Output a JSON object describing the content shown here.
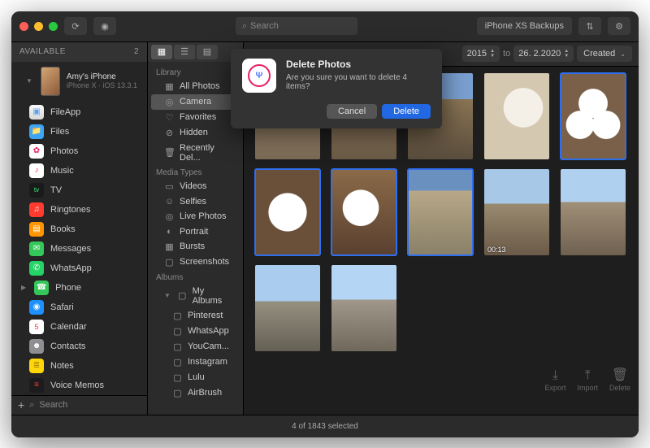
{
  "titlebar": {
    "search_placeholder": "Search",
    "backups_label": "iPhone XS  Backups"
  },
  "sidebar": {
    "header": "AVAILABLE",
    "count": "2",
    "device": {
      "name": "Amy's iPhone",
      "sub": "iPhone X · iOS 13.3.1"
    },
    "apps": [
      {
        "label": "FileApp",
        "bg": "linear-gradient(#f8f8f8,#d8d8d8)",
        "fg": "#5aa0f0",
        "glyph": "▣"
      },
      {
        "label": "Files",
        "bg": "#3ea5f5",
        "glyph": "📁"
      },
      {
        "label": "Photos",
        "bg": "#fff",
        "fg": "#e91e63",
        "glyph": "✿"
      },
      {
        "label": "Music",
        "bg": "#fff",
        "fg": "#fa2d48",
        "glyph": "♪"
      },
      {
        "label": "TV",
        "bg": "#1a1a1a",
        "glyph": "tv",
        "fg": "#3bf07a",
        "fs": "8px"
      },
      {
        "label": "Ringtones",
        "bg": "#ff3b30",
        "glyph": "♫"
      },
      {
        "label": "Books",
        "bg": "#ff9500",
        "glyph": "▤"
      },
      {
        "label": "Messages",
        "bg": "#34c759",
        "glyph": "✉"
      },
      {
        "label": "WhatsApp",
        "bg": "#25d366",
        "glyph": "✆"
      },
      {
        "label": "Phone",
        "bg": "#34c759",
        "glyph": "☎",
        "caret": true
      },
      {
        "label": "Safari",
        "bg": "#1e90ff",
        "glyph": "◉"
      },
      {
        "label": "Calendar",
        "bg": "#fff",
        "fg": "#ff3b30",
        "glyph": "5",
        "fs": "9px"
      },
      {
        "label": "Contacts",
        "bg": "#8e8e93",
        "glyph": "☻"
      },
      {
        "label": "Notes",
        "bg": "#ffd60a",
        "fg": "#aa8a00",
        "glyph": "≣"
      },
      {
        "label": "Voice Memos",
        "bg": "#1c1c1e",
        "fg": "#ff3b30",
        "glyph": "≡"
      }
    ],
    "footer_search": "Search"
  },
  "midcol": {
    "library_header": "Library",
    "library": [
      {
        "icon": "▦",
        "label": "All Photos"
      },
      {
        "icon": "◎",
        "label": "Camera",
        "selected": true
      },
      {
        "icon": "♡",
        "label": "Favorites"
      },
      {
        "icon": "⊘",
        "label": "Hidden"
      },
      {
        "icon": "🗑",
        "label": "Recently Del..."
      }
    ],
    "media_header": "Media Types",
    "media": [
      {
        "icon": "▭",
        "label": "Videos"
      },
      {
        "icon": "☺",
        "label": "Selfies"
      },
      {
        "icon": "◎",
        "label": "Live Photos"
      },
      {
        "icon": "◐",
        "label": "Portrait"
      },
      {
        "icon": "▦",
        "label": "Bursts"
      },
      {
        "icon": "▢",
        "label": "Screenshots"
      }
    ],
    "albums_header": "Albums",
    "my_albums_label": "My Albums",
    "albums": [
      {
        "label": "Pinterest"
      },
      {
        "label": "WhatsApp"
      },
      {
        "label": "YouCam..."
      },
      {
        "label": "Instagram"
      },
      {
        "label": "Lulu"
      },
      {
        "label": "AirBrush"
      }
    ]
  },
  "content": {
    "date_from": "2015",
    "date_to": "26.  2.2020",
    "sort_label": "Created",
    "status": "4 of 1843 selected",
    "actions": {
      "export": "Export",
      "import": "Import",
      "delete": "Delete"
    },
    "thumbs": [
      {
        "cls": "p-street1"
      },
      {
        "cls": "p-street2"
      },
      {
        "cls": "p-street3"
      },
      {
        "cls": "p-food1"
      },
      {
        "cls": "p-food2",
        "selected": true
      },
      {
        "cls": "p-food3",
        "selected": true
      },
      {
        "cls": "p-food4",
        "selected": true
      },
      {
        "cls": "p-street4",
        "selected": true
      },
      {
        "cls": "p-city1",
        "duration": "00:13"
      },
      {
        "cls": "p-city2"
      },
      {
        "cls": "p-city3"
      },
      {
        "cls": "p-city4"
      }
    ]
  },
  "dialog": {
    "title": "Delete Photos",
    "message": "Are you sure you want to delete 4 items?",
    "cancel": "Cancel",
    "delete": "Delete"
  }
}
